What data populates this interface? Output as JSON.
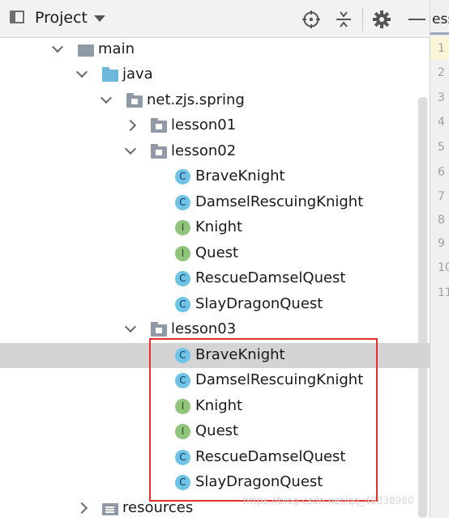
{
  "toolbar": {
    "title": "Project",
    "icons": [
      "project-view-icon",
      "dropdown-caret-icon",
      "locate-crosshair-icon",
      "collapse-all-icon",
      "settings-gear-icon",
      "hide-minus-icon"
    ]
  },
  "editor": {
    "tab_fragment": "ess",
    "line_numbers": [
      "1",
      "2",
      "3",
      "4",
      "5",
      "6",
      "7",
      "8",
      "9",
      "10",
      "11"
    ]
  },
  "tree": [
    {
      "label": "main",
      "icon": "folder-icon",
      "indent": 0,
      "arrow": "down"
    },
    {
      "label": "java",
      "icon": "source-folder-icon",
      "indent": 1,
      "arrow": "down"
    },
    {
      "label": "net.zjs.spring",
      "icon": "package-icon",
      "indent": 2,
      "arrow": "down"
    },
    {
      "label": "lesson01",
      "icon": "package-icon",
      "indent": 3,
      "arrow": "right"
    },
    {
      "label": "lesson02",
      "icon": "package-icon",
      "indent": 3,
      "arrow": "down"
    },
    {
      "label": "BraveKnight",
      "icon": "class-icon",
      "indent": 4
    },
    {
      "label": "DamselRescuingKnight",
      "icon": "class-icon",
      "indent": 4
    },
    {
      "label": "Knight",
      "icon": "interface-icon",
      "indent": 4
    },
    {
      "label": "Quest",
      "icon": "interface-icon",
      "indent": 4
    },
    {
      "label": "RescueDamselQuest",
      "icon": "class-icon",
      "indent": 4
    },
    {
      "label": "SlayDragonQuest",
      "icon": "class-icon",
      "indent": 4
    },
    {
      "label": "lesson03",
      "icon": "package-icon",
      "indent": 3,
      "arrow": "down"
    },
    {
      "label": "BraveKnight",
      "icon": "class-icon",
      "indent": 4,
      "selected": true
    },
    {
      "label": "DamselRescuingKnight",
      "icon": "class-icon",
      "indent": 4
    },
    {
      "label": "Knight",
      "icon": "interface-icon",
      "indent": 4
    },
    {
      "label": "Quest",
      "icon": "interface-icon",
      "indent": 4
    },
    {
      "label": "RescueDamselQuest",
      "icon": "class-icon",
      "indent": 4
    },
    {
      "label": "SlayDragonQuest",
      "icon": "class-icon",
      "indent": 4
    },
    {
      "label": "resources",
      "icon": "resources-folder-icon",
      "indent": 1,
      "arrow": "right"
    }
  ],
  "class_letter": "C",
  "interface_letter": "I",
  "watermark": "https://blog.csdn.net/qq_48838980",
  "colors": {
    "highlight_box": "#e5312e",
    "selected_row": "#d4d4d4",
    "class_icon": "#6fc3e6",
    "interface_icon": "#8fc47a"
  }
}
